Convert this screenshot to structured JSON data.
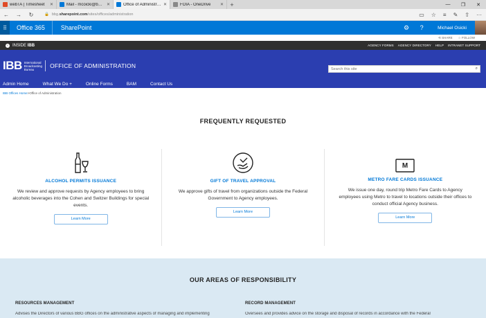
{
  "browser": {
    "tabs": [
      {
        "label": "webTA | Timesheet",
        "color": "#e04a26",
        "active": false
      },
      {
        "label": "Mail - mcoicki@bbg.gov",
        "color": "#0078d7",
        "active": false
      },
      {
        "label": "Office of Administratio",
        "color": "#0078d7",
        "active": true
      },
      {
        "label": "FOIA - OneDrive",
        "color": "#888888",
        "active": false
      }
    ],
    "url_prefix": "bbg.",
    "url_domain": "sharepoint.com",
    "url_path": "/sites/offices/administration"
  },
  "suitebar": {
    "app": "Office 365",
    "product": "SharePoint",
    "user": "Michael Osicki"
  },
  "sharebar": {
    "share": "SHARE",
    "follow": "FOLLOW"
  },
  "insidebar": {
    "label": "INSIDE",
    "label_brand": "IBB",
    "links": [
      "AGENCY FORMS",
      "AGENCY DIRECTORY",
      "HELP",
      "INTRANET SUPPORT"
    ]
  },
  "header": {
    "logo": "IBB",
    "logo_sub": [
      "International",
      "Broadcasting",
      "Bureau"
    ],
    "office": "OFFICE OF ADMINISTRATION",
    "search_placeholder": "Search this site"
  },
  "menu": [
    "Admin Home",
    "What We Do +",
    "Online Forms",
    "BAM",
    "Contact Us"
  ],
  "breadcrumb": {
    "home": "IBB Offices Home",
    "sep": " > ",
    "current": "Office of Administration"
  },
  "frequently": {
    "title": "FREQUENTLY REQUESTED",
    "cards": [
      {
        "icon": "wine-bottle-icon",
        "title": "ALCOHOL PERMITS ISSUANCE",
        "text": "We review and approve requests by Agency employees to bring alcoholic beverages into the Cohen and Switzer Buildings for special events.",
        "button": "Learn More"
      },
      {
        "icon": "gift-hand-icon",
        "title": "GIFT OF TRAVEL APPROVAL",
        "text": "We approve gifts of travel from organizations outside the Federal Government to Agency employees.",
        "button": "Learn More"
      },
      {
        "icon": "metro-card-icon",
        "title": "METRO FARE CARDS ISSUANCE",
        "text": "We issue one day, round trip Metro Fare Cards to Agency employees using Metro to travel to locations outside their offices to conduct official Agency business.",
        "button": "Learn More"
      }
    ]
  },
  "areas": {
    "title": "OUR AREAS OF RESPONSIBILITY",
    "columns": [
      {
        "heading": "RESOURCES MANAGEMENT",
        "text": "Advises the Directors of various BBG offices on the administrative aspects of managing and implementing"
      },
      {
        "heading": "RECORD MANAGEMENT",
        "text": "Oversees and provides advice on the storage and disposal of records in accordance with the Federal"
      }
    ]
  }
}
